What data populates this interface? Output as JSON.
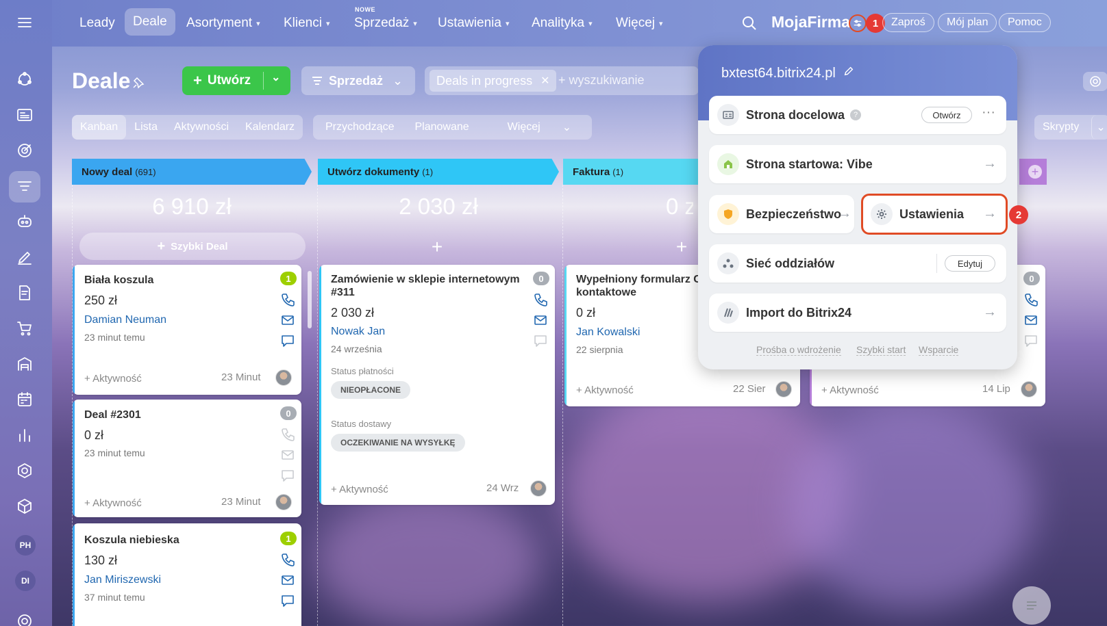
{
  "topnav": {
    "items": [
      {
        "label": "Leady",
        "active": false
      },
      {
        "label": "Deale",
        "active": true
      },
      {
        "label": "Asortyment",
        "active": false
      },
      {
        "label": "Klienci",
        "active": false
      },
      {
        "label": "Sprzedaż",
        "active": false,
        "tag": "NOWE"
      },
      {
        "label": "Ustawienia",
        "active": false
      },
      {
        "label": "Analityka",
        "active": false
      },
      {
        "label": "Więcej",
        "active": false
      }
    ],
    "brand": "MojaFirma",
    "invite": "Zaproś",
    "plan": "Mój plan",
    "help": "Pomoc"
  },
  "sidebar": {
    "icons": [
      "hamburger-icon",
      "hub-icon",
      "news-icon",
      "target-icon",
      "crm-filter-icon",
      "robot-icon",
      "pen-icon",
      "doc-sign-icon",
      "cart-icon",
      "warehouse-icon",
      "calendar-icon",
      "chart-bars-icon",
      "hexagon-icon",
      "cube-icon"
    ],
    "avatars": [
      "PH",
      "DI"
    ]
  },
  "toolbar": {
    "title": "Deale",
    "create": "Utwórz",
    "pipeline": "Sprzedaż",
    "filter_tag": "Deals in progress",
    "search_placeholder": "+ wyszukiwanie",
    "views": [
      "Kanban",
      "Lista",
      "Aktywności",
      "Kalendarz"
    ],
    "filters": [
      "Przychodzące",
      "Planowane",
      "Więcej"
    ],
    "scripts": "Skrypty"
  },
  "columns": [
    {
      "name": "Nowy deal",
      "count": "(691)",
      "sum": "6 910 zł",
      "color": "#3aa6f0"
    },
    {
      "name": "Utwórz dokumenty",
      "count": "(1)",
      "sum": "2 030 zł",
      "color": "#2fc6f6"
    },
    {
      "name": "Faktura",
      "count": "(1)",
      "sum": "0 zł",
      "color": "#56d8f2"
    }
  ],
  "quick_deal": "Szybki Deal",
  "cards": [
    {
      "title": "Biała koszula",
      "amount": "250 zł",
      "contact": "Damian Neuman",
      "time": "23 minut temu",
      "badge": "1",
      "activity": "+ Aktywność",
      "date": "23 Minut"
    },
    {
      "title": "Deal #2301",
      "amount": "0 zł",
      "contact": "",
      "time": "23 minut temu",
      "badge": "0",
      "activity": "+ Aktywność",
      "date": "23 Minut"
    },
    {
      "title": "Koszula niebieska",
      "amount": "130 zł",
      "contact": "Jan Miriszewski",
      "time": "37 minut temu",
      "badge": "1"
    },
    {
      "title": "Zamówienie w sklepie internetowym #311",
      "amount": "2 030 zł",
      "contact": "Nowak Jan",
      "time": "24 września",
      "badge": "0",
      "pay_label": "Status płatności",
      "pay_value": "NIEOPŁACONE",
      "ship_label": "Status dostawy",
      "ship_value": "OCZEKIWANIE NA WYSYŁKĘ",
      "activity": "+ Aktywność",
      "date": "24 Wrz"
    },
    {
      "title": "Wypełniony formularz C \"Informacje kontaktowe",
      "amount": "0 zł",
      "contact": "Jan Kowalski",
      "time": "22 sierpnia",
      "activity": "+ Aktywność",
      "date": "22 Sier"
    },
    {
      "badge": "0",
      "activity": "+ Aktywność",
      "date": "14 Lip"
    }
  ],
  "popup": {
    "domain": "bxtest64.bitrix24.pl",
    "landing": "Strona docelowa",
    "open": "Otwórz",
    "start_page": "Strona startowa: Vibe",
    "security": "Bezpieczeństwo",
    "settings": "Ustawienia",
    "branches": "Sieć oddziałów",
    "edit": "Edytuj",
    "import": "Import do Bitrix24",
    "footer": [
      "Prośba o wdrożenie",
      "Szybki start",
      "Wsparcie"
    ]
  },
  "markers": [
    "1",
    "2"
  ],
  "colors": {
    "green": "#3bc64a",
    "accent_red": "#e04b25",
    "link": "#2067b0"
  }
}
